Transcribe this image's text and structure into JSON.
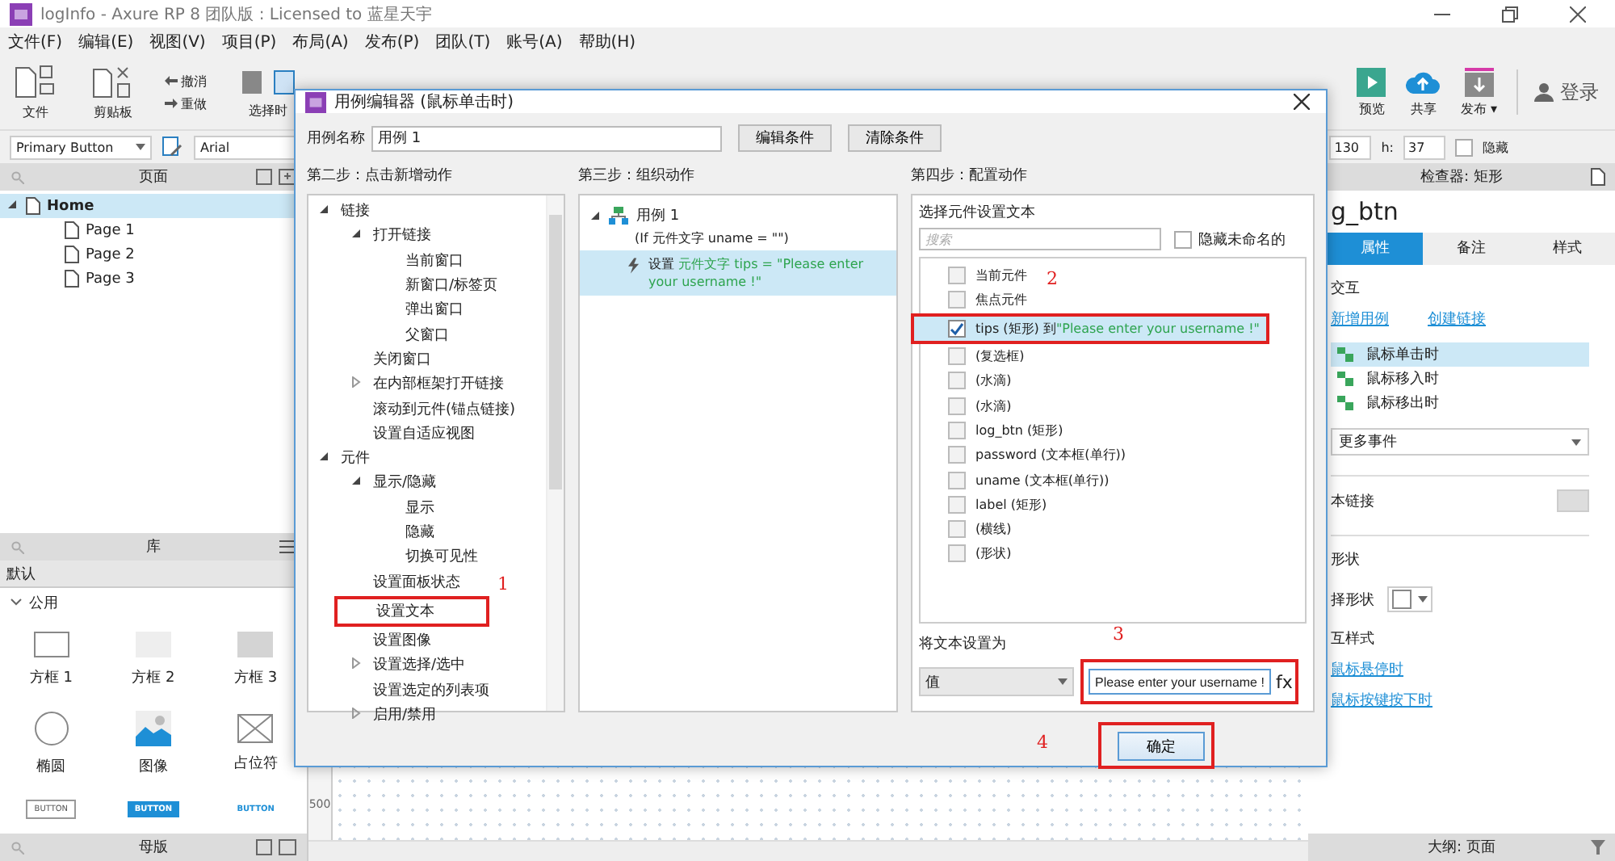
{
  "window": {
    "title": "logInfo - Axure RP 8 团队版 : Licensed to 蓝星天宇"
  },
  "menu": [
    "文件(F)",
    "编辑(E)",
    "视图(V)",
    "项目(P)",
    "布局(A)",
    "发布(P)",
    "团队(T)",
    "账号(A)",
    "帮助(H)"
  ],
  "toolbar": {
    "left": [
      {
        "label": "文件",
        "kind": "file"
      },
      {
        "label": "剪贴板",
        "kind": "clipboard"
      }
    ],
    "undo": "撤消",
    "redo": "重做",
    "select": "选择时",
    "right": [
      {
        "label": "预览",
        "kind": "preview"
      },
      {
        "label": "共享",
        "kind": "share"
      },
      {
        "label": "发布 ▾",
        "kind": "publish"
      }
    ],
    "login": "登录"
  },
  "format_bar": {
    "style": "Primary Button",
    "font": "Arial",
    "w_value": "130",
    "h_label": "h:",
    "h_value": "37",
    "hidden_label": "隐藏",
    "hidden_checked": false
  },
  "pages": {
    "title": "页面",
    "tree": [
      {
        "label": "Home",
        "selected": true,
        "expanded": true,
        "children": [
          {
            "label": "Page 1",
            "selected": false
          },
          {
            "label": "Page 2",
            "selected": false
          },
          {
            "label": "Page 3",
            "selected": false
          }
        ]
      }
    ]
  },
  "library": {
    "title": "库",
    "source": "默认",
    "section": "公用",
    "section_expanded": true,
    "widgets": [
      {
        "label": "方框 1",
        "kind": "box1"
      },
      {
        "label": "方框 2",
        "kind": "box2"
      },
      {
        "label": "方框 3",
        "kind": "box3"
      },
      {
        "label": "椭圆",
        "kind": "ellipse"
      },
      {
        "label": "图像",
        "kind": "image"
      },
      {
        "label": "占位符",
        "kind": "placeholder"
      },
      {
        "label": "BUTTON",
        "kind": "button"
      },
      {
        "label": "BUTTON",
        "kind": "primary"
      },
      {
        "label": "BUTTON",
        "kind": "link"
      }
    ]
  },
  "masters": {
    "title": "母版"
  },
  "canvas": {
    "ruler_mark": "500"
  },
  "inspector": {
    "title": "检查器: 矩形",
    "name": "g_btn",
    "tabs": [
      {
        "label": "属性",
        "selected": true
      },
      {
        "label": "备注",
        "selected": false
      },
      {
        "label": "样式",
        "selected": false
      }
    ],
    "section": "交互",
    "add_case": "新增用例",
    "create_link": "创建链接",
    "events": [
      {
        "label": "鼠标单击时",
        "selected": true
      },
      {
        "label": "鼠标移入时",
        "selected": false
      },
      {
        "label": "鼠标移出时",
        "selected": false
      }
    ],
    "more_events": "更多事件",
    "text_link": "本链接",
    "shape_section": "形状",
    "shape_picker": "择形状",
    "interaction_styles": "互样式",
    "style_links": [
      "鼠标悬停时",
      "鼠标按键按下时"
    ],
    "outline": "大纲: 页面"
  },
  "dialog": {
    "title": "用例编辑器 (鼠标单击时)",
    "case_name_label": "用例名称",
    "case_name": "用例 1",
    "edit_condition": "编辑条件",
    "clear_condition": "清除条件",
    "step2": {
      "title": "第二步：点击新增动作",
      "tree": [
        {
          "label": "链接",
          "expanded": true,
          "children": [
            {
              "label": "打开链接",
              "expanded": true,
              "children": [
                {
                  "label": "当前窗口"
                },
                {
                  "label": "新窗口/标签页"
                },
                {
                  "label": "弹出窗口"
                },
                {
                  "label": "父窗口"
                }
              ]
            },
            {
              "label": "关闭窗口"
            },
            {
              "label": "在内部框架打开链接",
              "expanded": false
            },
            {
              "label": "滚动到元件(锚点链接)"
            },
            {
              "label": "设置自适应视图"
            }
          ]
        },
        {
          "label": "元件",
          "expanded": true,
          "children": [
            {
              "label": "显示/隐藏",
              "expanded": true,
              "children": [
                {
                  "label": "显示"
                },
                {
                  "label": "隐藏"
                },
                {
                  "label": "切换可见性"
                }
              ]
            },
            {
              "label": "设置面板状态"
            },
            {
              "label": "设置文本",
              "callout": "1"
            },
            {
              "label": "设置图像"
            },
            {
              "label": "设置选择/选中",
              "expanded": false
            },
            {
              "label": "设置选定的列表项"
            },
            {
              "label": "启用/禁用",
              "expanded": false
            }
          ]
        }
      ]
    },
    "step3": {
      "title": "第三步：组织动作",
      "case": {
        "label": "用例 1",
        "condition": "(If 元件文字 uname = \"\")",
        "expanded": true
      },
      "actions": [
        {
          "verb": "设置",
          "detail": "元件文字 tips = \"Please enter your username !\"",
          "selected": true
        }
      ]
    },
    "step4": {
      "title": "第四步：配置动作",
      "subtitle": "选择元件设置文本",
      "search_placeholder": "搜索",
      "hide_unnamed": "隐藏未命名的",
      "hide_unnamed_checked": false,
      "widgets": [
        {
          "label": "当前元件",
          "checked": false,
          "selected": false
        },
        {
          "label": "焦点元件",
          "checked": false,
          "selected": false
        },
        {
          "label": "tips (矩形) 到",
          "value": "\"Please enter your username !\"",
          "checked": true,
          "selected": true,
          "callout": "2"
        },
        {
          "label": "(复选框)",
          "checked": false,
          "selected": false
        },
        {
          "label": "(水滴)",
          "checked": false,
          "selected": false
        },
        {
          "label": "(水滴)",
          "checked": false,
          "selected": false
        },
        {
          "label": "log_btn (矩形)",
          "checked": false,
          "selected": false
        },
        {
          "label": "password (文本框(单行))",
          "checked": false,
          "selected": false
        },
        {
          "label": "uname (文本框(单行))",
          "checked": false,
          "selected": false
        },
        {
          "label": "label (矩形)",
          "checked": false,
          "selected": false
        },
        {
          "label": "(横线)",
          "checked": false,
          "selected": false
        },
        {
          "label": "(形状)",
          "checked": false,
          "selected": false
        }
      ],
      "set_to_label": "将文本设置为",
      "value_type": "值",
      "value": "Please enter your username !",
      "value_callout": "3",
      "fx": "fx"
    },
    "ok": "确定",
    "ok_callout": "4"
  }
}
